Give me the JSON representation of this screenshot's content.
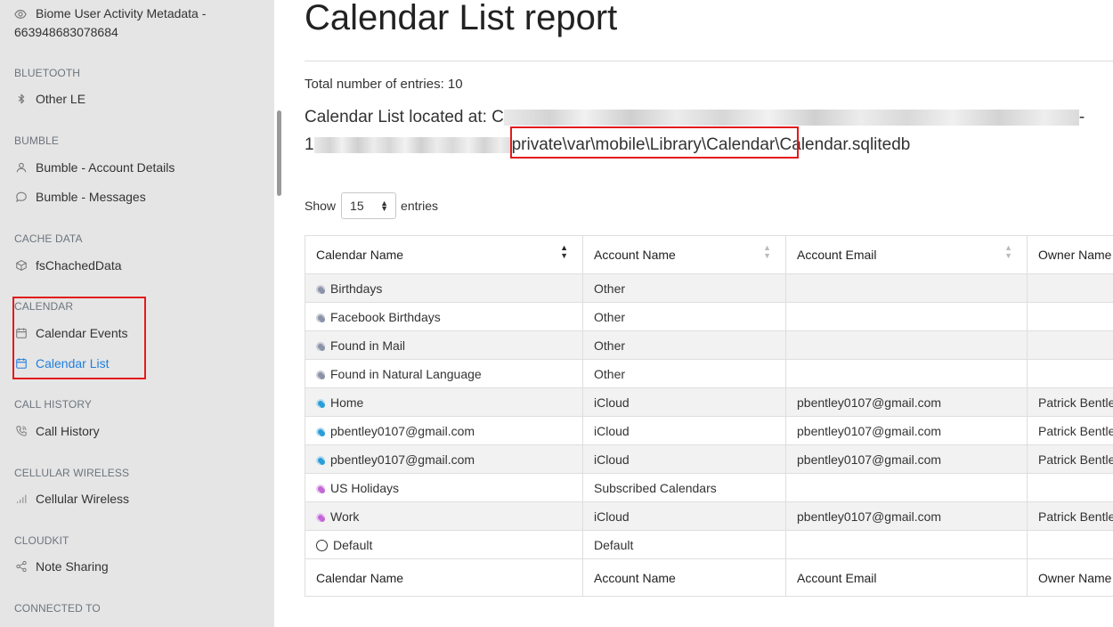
{
  "sidebar": {
    "top_item": {
      "label_line1": "Biome User Activity Metadata -",
      "label_line2": "663948683078684",
      "icon": "eye-icon"
    },
    "sections": [
      {
        "heading": "BLUETOOTH",
        "items": [
          {
            "label": "Other LE",
            "icon": "bluetooth-icon"
          }
        ]
      },
      {
        "heading": "BUMBLE",
        "items": [
          {
            "label": "Bumble - Account Details",
            "icon": "user-icon"
          },
          {
            "label": "Bumble - Messages",
            "icon": "message-icon"
          }
        ]
      },
      {
        "heading": "CACHE DATA",
        "items": [
          {
            "label": "fsChachedData",
            "icon": "box-icon"
          }
        ]
      },
      {
        "heading": "CALENDAR",
        "items": [
          {
            "label": "Calendar Events",
            "icon": "calendar-icon"
          },
          {
            "label": "Calendar List",
            "icon": "calendar-icon",
            "active": true
          }
        ]
      },
      {
        "heading": "CALL HISTORY",
        "items": [
          {
            "label": "Call History",
            "icon": "phone-icon"
          }
        ]
      },
      {
        "heading": "CELLULAR WIRELESS",
        "items": [
          {
            "label": "Cellular Wireless",
            "icon": "signal-bars-icon"
          }
        ]
      },
      {
        "heading": "CLOUDKIT",
        "items": [
          {
            "label": "Note Sharing",
            "icon": "share-icon"
          }
        ]
      },
      {
        "heading": "CONNECTED TO",
        "items": []
      }
    ]
  },
  "main": {
    "title": "Calendar List report",
    "total_entries": "Total number of entries: 10",
    "location_prefix": "Calendar List located at: C",
    "location_line2_start": "1",
    "location_path": "private\\var\\mobile\\Library\\Calendar\\",
    "location_file": "Calendar.sqlitedb",
    "location_line1_end": "-",
    "show_label": "Show",
    "show_value": "15",
    "entries_label": "entries"
  },
  "table": {
    "columns": [
      "Calendar Name",
      "Account Name",
      "Account Email",
      "Owner Name"
    ],
    "rows": [
      {
        "color": "gray",
        "name": "Birthdays",
        "account": "Other",
        "email": "",
        "owner": ""
      },
      {
        "color": "gray",
        "name": "Facebook Birthdays",
        "account": "Other",
        "email": "",
        "owner": ""
      },
      {
        "color": "gray",
        "name": "Found in Mail",
        "account": "Other",
        "email": "",
        "owner": ""
      },
      {
        "color": "gray",
        "name": "Found in Natural Language",
        "account": "Other",
        "email": "",
        "owner": ""
      },
      {
        "color": "blue",
        "name": "Home",
        "account": "iCloud",
        "email": "pbentley0107@gmail.com",
        "owner": "Patrick Bentley"
      },
      {
        "color": "blue",
        "name": "pbentley0107@gmail.com",
        "account": "iCloud",
        "email": "pbentley0107@gmail.com",
        "owner": "Patrick Bentley"
      },
      {
        "color": "blue",
        "name": "pbentley0107@gmail.com",
        "account": "iCloud",
        "email": "pbentley0107@gmail.com",
        "owner": "Patrick Bentley"
      },
      {
        "color": "purple",
        "name": "US Holidays",
        "account": "Subscribed Calendars",
        "email": "",
        "owner": ""
      },
      {
        "color": "purple",
        "name": "Work",
        "account": "iCloud",
        "email": "pbentley0107@gmail.com",
        "owner": "Patrick Bentley"
      },
      {
        "color": "empty",
        "name": "Default",
        "account": "Default",
        "email": "",
        "owner": ""
      }
    ]
  },
  "colors": {
    "highlight_border": "#e31b1b",
    "active_link": "#1e7fe0",
    "sidebar_bg": "#e5e5e5"
  }
}
